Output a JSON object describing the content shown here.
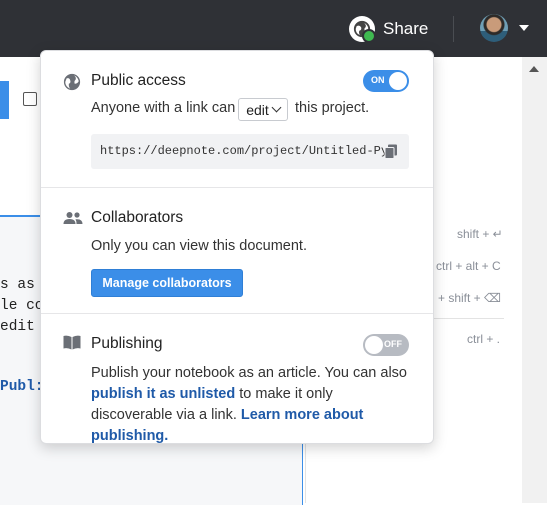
{
  "topbar": {
    "share_label": "Share",
    "share_icon": "share-globe-icon",
    "avatar": "user-avatar"
  },
  "background": {
    "code_lines": [
      "s as",
      "le co",
      "edit",
      "Publ:"
    ],
    "shortcuts": [
      "shift + ↵",
      "ctrl + alt + C",
      "l + shift + ⌫",
      "ctrl + ."
    ]
  },
  "popover": {
    "public_access": {
      "title": "Public access",
      "icon": "globe-icon",
      "toggle_label": "ON",
      "toggle_state": "on",
      "text_before": "Anyone with a link can",
      "permission_value": "edit",
      "text_after": "this project.",
      "link_url": "https://deepnote.com/project/Untitled-Py…"
    },
    "collaborators": {
      "title": "Collaborators",
      "icon": "people-icon",
      "text": "Only you can view this document.",
      "button_label": "Manage collaborators"
    },
    "publishing": {
      "title": "Publishing",
      "icon": "book-icon",
      "toggle_label": "OFF",
      "toggle_state": "off",
      "text_1": "Publish your notebook as an article. You can also",
      "link_1": "publish it as unlisted",
      "text_2": "to make it only discoverable via a link.",
      "link_2": "Learn more about publishing."
    }
  },
  "colors": {
    "accent": "#3b8ee8",
    "topbar": "#2f3136",
    "link": "#1f5aa8"
  }
}
